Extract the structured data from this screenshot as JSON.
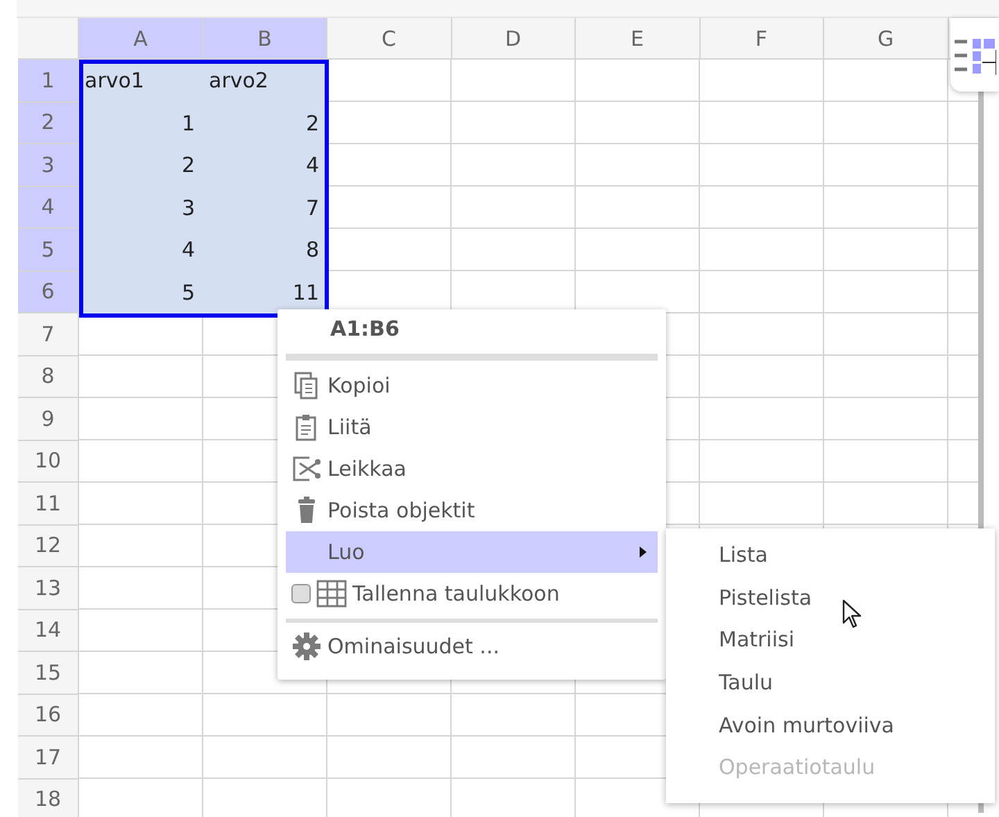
{
  "columns": [
    {
      "label": "A",
      "selected": true
    },
    {
      "label": "B",
      "selected": true
    },
    {
      "label": "C",
      "selected": false
    },
    {
      "label": "D",
      "selected": false
    },
    {
      "label": "E",
      "selected": false
    },
    {
      "label": "F",
      "selected": false
    },
    {
      "label": "G",
      "selected": false
    }
  ],
  "rows": [
    {
      "number": "1",
      "selected": true,
      "cells": [
        {
          "text": "arvo1",
          "kind": "text"
        },
        {
          "text": "arvo2",
          "kind": "text"
        }
      ]
    },
    {
      "number": "2",
      "selected": true,
      "cells": [
        {
          "text": "1",
          "kind": "number"
        },
        {
          "text": "2",
          "kind": "number"
        }
      ]
    },
    {
      "number": "3",
      "selected": true,
      "cells": [
        {
          "text": "2",
          "kind": "number"
        },
        {
          "text": "4",
          "kind": "number"
        }
      ]
    },
    {
      "number": "4",
      "selected": true,
      "cells": [
        {
          "text": "3",
          "kind": "number"
        },
        {
          "text": "7",
          "kind": "number"
        }
      ]
    },
    {
      "number": "5",
      "selected": true,
      "cells": [
        {
          "text": "4",
          "kind": "number"
        },
        {
          "text": "8",
          "kind": "number"
        }
      ]
    },
    {
      "number": "6",
      "selected": true,
      "cells": [
        {
          "text": "5",
          "kind": "number"
        },
        {
          "text": "11",
          "kind": "number"
        }
      ]
    },
    {
      "number": "7",
      "selected": false
    },
    {
      "number": "8",
      "selected": false
    },
    {
      "number": "9",
      "selected": false
    },
    {
      "number": "10",
      "selected": false
    },
    {
      "number": "11",
      "selected": false
    },
    {
      "number": "12",
      "selected": false
    },
    {
      "number": "13",
      "selected": false
    },
    {
      "number": "14",
      "selected": false
    },
    {
      "number": "15",
      "selected": false
    },
    {
      "number": "16",
      "selected": false
    },
    {
      "number": "17",
      "selected": false
    },
    {
      "number": "18",
      "selected": false
    }
  ],
  "context_menu": {
    "title": "A1:B6",
    "items": [
      {
        "kind": "copy",
        "label": "Kopioi",
        "selected": false
      },
      {
        "kind": "paste",
        "label": "Liitä",
        "selected": false
      },
      {
        "kind": "cut",
        "label": "Leikkaa",
        "selected": false
      },
      {
        "kind": "delete",
        "label": "Poista objektit",
        "selected": false
      },
      {
        "kind": "submenu",
        "label": "Luo",
        "selected": true
      },
      {
        "kind": "checkbox",
        "label": "Tallenna taulukkoon",
        "selected": false,
        "checked": false
      },
      {
        "kind": "separator"
      },
      {
        "kind": "settings",
        "label": "Ominaisuudet ...",
        "selected": false
      }
    ]
  },
  "submenu": {
    "items": [
      {
        "label": "Lista",
        "disabled": false
      },
      {
        "label": "Pistelista",
        "disabled": false
      },
      {
        "label": "Matriisi",
        "disabled": false
      },
      {
        "label": "Taulu",
        "disabled": false
      },
      {
        "label": "Avoin murtoviiva",
        "disabled": false
      },
      {
        "label": "Operaatiotaulu",
        "disabled": true
      }
    ]
  }
}
